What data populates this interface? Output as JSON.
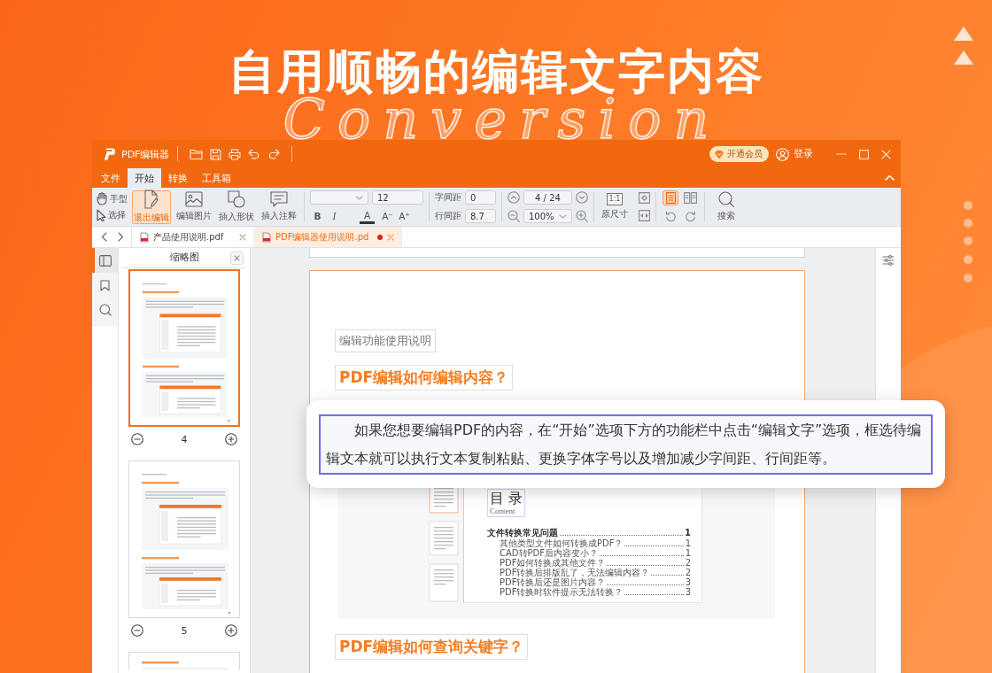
{
  "banner": {
    "headline": "自用顺畅的编辑文字内容",
    "background_word": "Conversion"
  },
  "window": {
    "app_name": "PDF编辑器",
    "vip_button": "开通会员",
    "login": "登录"
  },
  "menu_tabs": [
    {
      "label": "文件",
      "selected": false
    },
    {
      "label": "开始",
      "selected": true
    },
    {
      "label": "转换",
      "selected": false
    },
    {
      "label": "工具箱",
      "selected": false
    }
  ],
  "toolbar": {
    "modes": [
      "手型",
      "选择"
    ],
    "edit_tools": [
      {
        "label": "退出编辑",
        "selected": true
      },
      {
        "label": "编辑图片",
        "selected": false
      },
      {
        "label": "插入形状",
        "selected": false
      },
      {
        "label": "插入注释",
        "selected": false
      }
    ],
    "font_size": "12",
    "format_buttons": [
      {
        "kind": "bold",
        "label": "B"
      },
      {
        "kind": "italic",
        "label": "I"
      },
      {
        "kind": "color",
        "label": "A"
      },
      {
        "kind": "shrink",
        "label": "A⁻"
      },
      {
        "kind": "grow",
        "label": "A⁺"
      }
    ],
    "char_spacing": {
      "label": "字间距",
      "value": "0"
    },
    "line_spacing": {
      "label": "行间距",
      "value": "8.7"
    },
    "page_indicator": "4 / 24",
    "zoom": "100%",
    "actual_size": {
      "glyph": "1:1",
      "label": "原尺寸"
    },
    "page_layout": [
      {
        "selected": true
      },
      {
        "selected": false
      }
    ],
    "search": "搜索"
  },
  "doc_tabs": [
    {
      "title": "产品使用说明.pdf",
      "selected": false,
      "modified": false
    },
    {
      "title": "PDF编辑器使用说明.pd",
      "selected": true,
      "modified": true
    }
  ],
  "side_rail": [
    {
      "selected": true
    },
    {
      "selected": false
    },
    {
      "selected": false
    }
  ],
  "thumbnails": {
    "title": "缩略图",
    "pages": [
      {
        "number": "4",
        "selected": true
      },
      {
        "number": "5",
        "selected": false
      },
      {
        "selected": false
      }
    ]
  },
  "document": {
    "label_block": "编辑功能使用说明",
    "heading_1": "PDF编辑如何编辑内容？",
    "embedded_screenshot": {
      "toc_title": "目 录",
      "toc_subtitle": "Content",
      "section": {
        "title": "文件转换常见问题",
        "page": "1"
      },
      "entries": [
        {
          "title": "其他类型文件如何转换成PDF？",
          "page": "1"
        },
        {
          "title": "CAD转PDF后内容变小？",
          "page": "1"
        },
        {
          "title": "PDF如何转换成其他文件？",
          "page": "2"
        },
        {
          "title": "PDF转换后排版乱了，无法编辑内容？",
          "page": "2"
        },
        {
          "title": "PDF转换后还是图片内容？",
          "page": "3"
        },
        {
          "title": "PDF转换时软件提示无法转换？",
          "page": "3"
        }
      ]
    },
    "heading_2": "PDF编辑如何查询关键字？"
  },
  "callout": {
    "text": "如果您想要编辑PDF的内容，在“开始”选项下方的功能栏中点击“编辑文字”选项，框选待编辑文本就可以执行文本复制粘贴、更换字体字号以及增加减少字间距、行间距等。"
  }
}
